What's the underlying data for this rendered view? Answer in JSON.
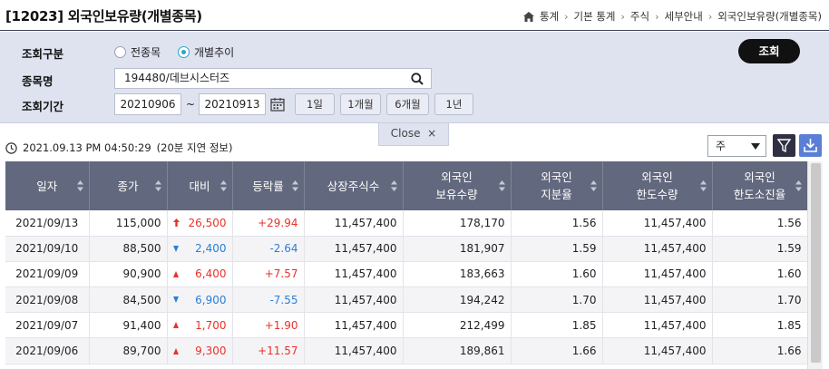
{
  "header": {
    "title": "[12023] 외국인보유량(개별종목)",
    "breadcrumb": [
      "통계",
      "기본 통계",
      "주식",
      "세부안내",
      "외국인보유량(개별종목)"
    ]
  },
  "search": {
    "row1_label": "조회구분",
    "radio_all": "전종목",
    "radio_individual": "개별추이",
    "selected": "개별추이",
    "row2_label": "종목명",
    "stock_value": "194480/데브시스터즈",
    "row3_label": "조회기간",
    "date_from": "20210906",
    "tilde": "~",
    "date_to": "20210913",
    "period_buttons": [
      "1일",
      "1개월",
      "6개월",
      "1년"
    ],
    "query_label": "조회",
    "close_label": "Close"
  },
  "toolbar": {
    "timestamp": "2021.09.13 PM 04:50:29",
    "delay_note": "(20분 지연 정보)",
    "period_value": "주"
  },
  "table": {
    "headers": [
      [
        "일자"
      ],
      [
        "종가"
      ],
      [
        "대비"
      ],
      [
        "등락률"
      ],
      [
        "상장주식수"
      ],
      [
        "외국인",
        "보유수량"
      ],
      [
        "외국인",
        "지분율"
      ],
      [
        "외국인",
        "한도수량"
      ],
      [
        "외국인",
        "한도소진율"
      ]
    ],
    "rows": [
      {
        "date": "2021/09/13",
        "close": "115,000",
        "dir": "upper",
        "change": "26,500",
        "rate": "+29.94",
        "listed": "11,457,400",
        "holding": "178,170",
        "share": "1.56",
        "limit": "11,457,400",
        "exhaust": "1.56"
      },
      {
        "date": "2021/09/10",
        "close": "88,500",
        "dir": "down",
        "change": "2,400",
        "rate": "-2.64",
        "listed": "11,457,400",
        "holding": "181,907",
        "share": "1.59",
        "limit": "11,457,400",
        "exhaust": "1.59"
      },
      {
        "date": "2021/09/09",
        "close": "90,900",
        "dir": "up",
        "change": "6,400",
        "rate": "+7.57",
        "listed": "11,457,400",
        "holding": "183,663",
        "share": "1.60",
        "limit": "11,457,400",
        "exhaust": "1.60"
      },
      {
        "date": "2021/09/08",
        "close": "84,500",
        "dir": "down",
        "change": "6,900",
        "rate": "-7.55",
        "listed": "11,457,400",
        "holding": "194,242",
        "share": "1.70",
        "limit": "11,457,400",
        "exhaust": "1.70"
      },
      {
        "date": "2021/09/07",
        "close": "91,400",
        "dir": "up",
        "change": "1,700",
        "rate": "+1.90",
        "listed": "11,457,400",
        "holding": "212,499",
        "share": "1.85",
        "limit": "11,457,400",
        "exhaust": "1.85"
      },
      {
        "date": "2021/09/06",
        "close": "89,700",
        "dir": "up",
        "change": "9,300",
        "rate": "+11.57",
        "listed": "11,457,400",
        "holding": "189,861",
        "share": "1.66",
        "limit": "11,457,400",
        "exhaust": "1.66"
      }
    ]
  },
  "colors": {
    "header_bg": "#62687d",
    "panel_bg": "#dfe3f0",
    "up": "#e8322b",
    "down": "#2a7fd4"
  }
}
